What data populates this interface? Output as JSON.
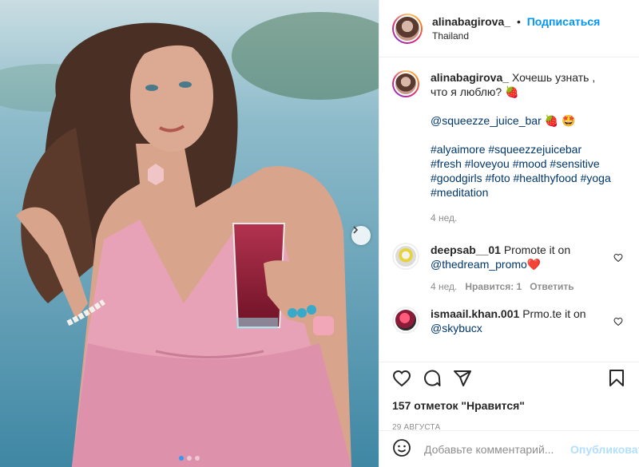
{
  "header": {
    "username": "alinabagirova_",
    "bullet": "•",
    "follow_label": "Подписаться",
    "location": "Thailand"
  },
  "caption": {
    "username": "alinabagirova_",
    "text": "Хочешь узнать , что я люблю?",
    "emoji1": "🍓",
    "mention": "@squeezze_juice_bar",
    "emoji2": "🍓 🤩",
    "hashtags": "#alyaimore #squeezzejuicebar #fresh #loveyou #mood #sensitive #goodgirls #foto #healthyfood #yoga #meditation",
    "time": "4 нед."
  },
  "comments": [
    {
      "username": "deepsab__01",
      "text": "Promote it on",
      "mention": "@thedream_promo",
      "emoji": "❤️",
      "time": "4 нед.",
      "likes": "Нравится: 1",
      "reply": "Ответить"
    },
    {
      "username": "ismaail.khan.001",
      "text": "Prmo.te it on",
      "mention": "@skybucx"
    }
  ],
  "actions": {
    "likes": "157 отметок \"Нравится\"",
    "date": "29 августа"
  },
  "add_comment": {
    "placeholder": "Добавьте комментарий...",
    "publish": "Опубликовать"
  },
  "carousel": {
    "slides": 3,
    "active": 0
  },
  "icons": [
    "like-icon",
    "comment-icon",
    "share-icon",
    "save-icon",
    "emoji-icon",
    "next-arrow-icon",
    "heart-icon"
  ],
  "colors": {
    "accent": "#0095f6",
    "link": "#00376b",
    "muted": "#8e8e8e",
    "dress": "#e8a2b8"
  }
}
